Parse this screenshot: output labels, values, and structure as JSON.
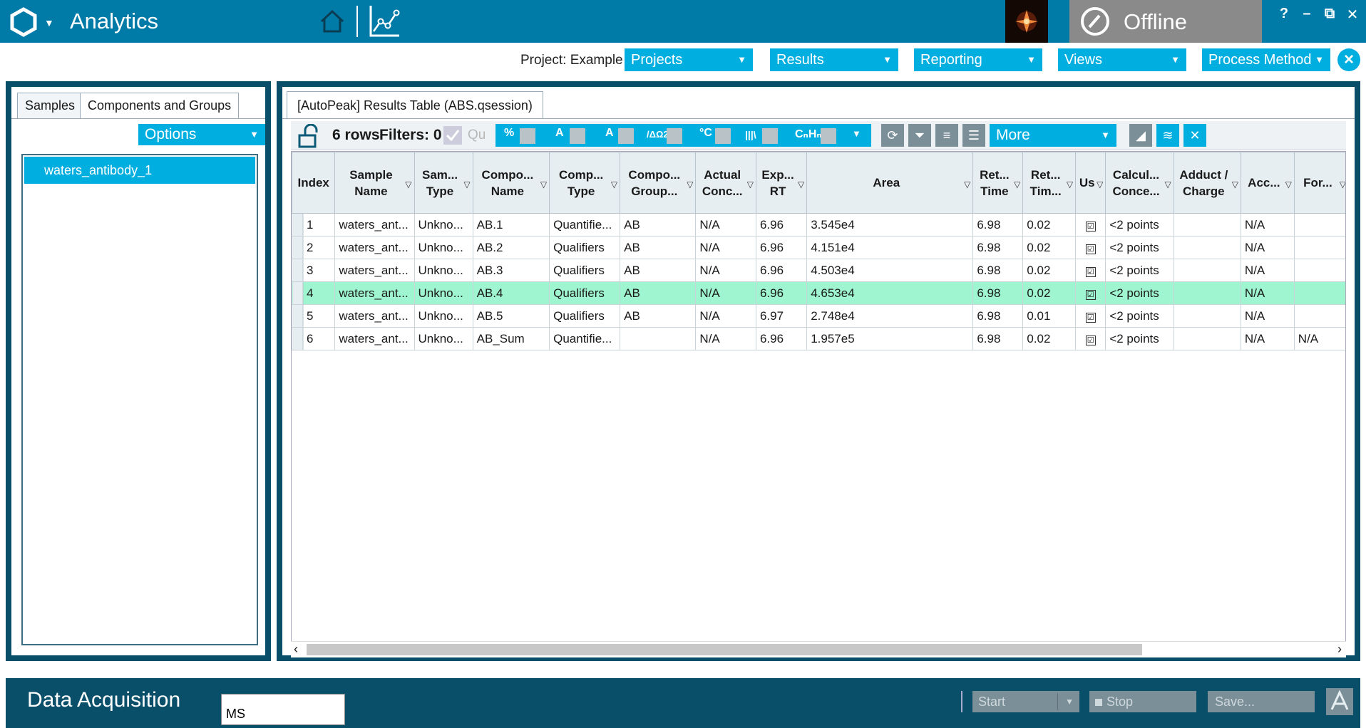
{
  "app": {
    "title": "Analytics",
    "status": "Offline"
  },
  "window_controls": {
    "help": "?",
    "minimize": "–",
    "restore": "⧉",
    "close": "✕"
  },
  "menu": {
    "project_label": "Project: Example",
    "items": [
      "Projects",
      "Results",
      "Reporting",
      "Views",
      "Process Method"
    ]
  },
  "left": {
    "tabs": [
      "Samples",
      "Components and Groups"
    ],
    "options_label": "Options",
    "samples": [
      "waters_antibody_1"
    ]
  },
  "results": {
    "tab_title": "[AutoPeak] Results Table (ABS.qsession)",
    "toolbar": {
      "rows_label": "6 rows",
      "filters_label": "Filters: 0",
      "qu_label": "Qu",
      "icons": [
        "%",
        "A",
        "A",
        "/ΔΩ2",
        "°C",
        "|||\\",
        "CₙHₙ"
      ],
      "more_label": "More"
    },
    "columns": [
      "Index",
      "Sample Name",
      "Sam... Type",
      "Compo... Name",
      "Comp... Type",
      "Compo... Group...",
      "Actual Conc...",
      "Exp... RT",
      "Area",
      "Ret... Time",
      "Ret... Tim...",
      "Us",
      "Calcul... Conce...",
      "Adduct / Charge",
      "Acc...",
      "For..."
    ],
    "rows": [
      [
        "1",
        "waters_ant...",
        "Unkno...",
        "AB.1",
        "Quantifie...",
        "AB",
        "N/A",
        "6.96",
        "3.545e4",
        "6.98",
        "0.02",
        "☑",
        "<2 points",
        "",
        "N/A",
        ""
      ],
      [
        "2",
        "waters_ant...",
        "Unkno...",
        "AB.2",
        "Qualifiers",
        "AB",
        "N/A",
        "6.96",
        "4.151e4",
        "6.98",
        "0.02",
        "☑",
        "<2 points",
        "",
        "N/A",
        ""
      ],
      [
        "3",
        "waters_ant...",
        "Unkno...",
        "AB.3",
        "Qualifiers",
        "AB",
        "N/A",
        "6.96",
        "4.503e4",
        "6.98",
        "0.02",
        "☑",
        "<2 points",
        "",
        "N/A",
        ""
      ],
      [
        "4",
        "waters_ant...",
        "Unkno...",
        "AB.4",
        "Qualifiers",
        "AB",
        "N/A",
        "6.96",
        "4.653e4",
        "6.98",
        "0.02",
        "☑",
        "<2 points",
        "",
        "N/A",
        ""
      ],
      [
        "5",
        "waters_ant...",
        "Unkno...",
        "AB.5",
        "Qualifiers",
        "AB",
        "N/A",
        "6.97",
        "2.748e4",
        "6.98",
        "0.01",
        "☑",
        "<2 points",
        "",
        "N/A",
        ""
      ],
      [
        "6",
        "waters_ant...",
        "Unkno...",
        "AB_Sum",
        "Quantifie...",
        "",
        "N/A",
        "6.96",
        "1.957e5",
        "6.98",
        "0.02",
        "☑",
        "<2 points",
        "",
        "N/A",
        "N/A"
      ]
    ],
    "selected_row_index": 3
  },
  "bottom": {
    "title": "Data Acquisition",
    "ms_value": "MS",
    "start_label": "Start",
    "stop_label": "Stop",
    "save_label": "Save..."
  },
  "colors": {
    "topbar": "#007ba7",
    "accent": "#00aee0",
    "panel_border": "#0a4f6a",
    "selected_row": "#9ff5cf",
    "offline_panel": "#8a8a8a",
    "disabled_button": "#7b8f98"
  }
}
